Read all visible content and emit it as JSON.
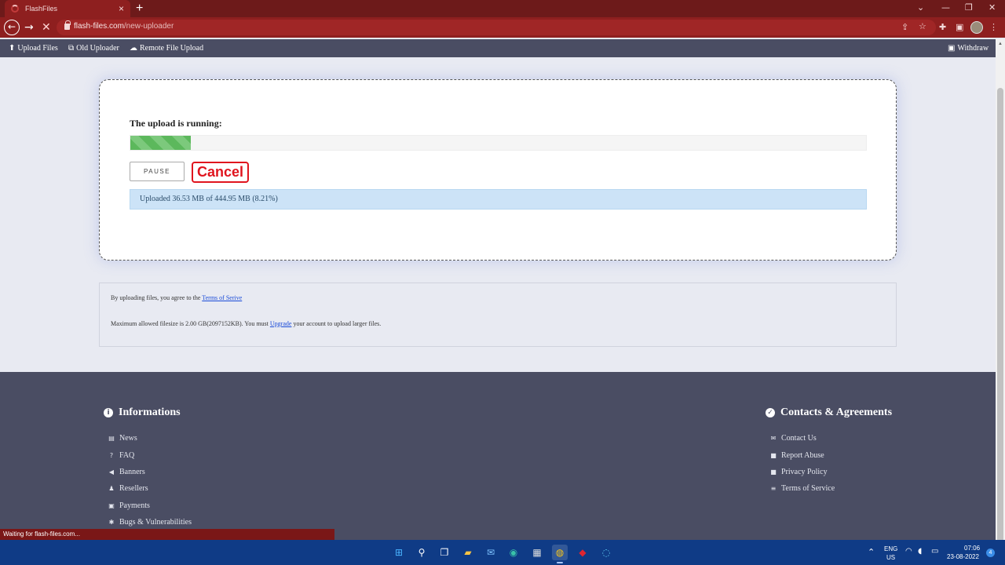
{
  "browser": {
    "tab_title": "FlashFiles",
    "url_domain": "flash-files.com",
    "url_path": "/new-uploader",
    "status_text": "Waiting for flash-files.com..."
  },
  "nav": {
    "upload_files": "Upload Files",
    "old_uploader": "Old Uploader",
    "remote_upload": "Remote File Upload",
    "withdraw": "Withdraw"
  },
  "upload": {
    "title": "The upload is running:",
    "progress_percent": 8.21,
    "pause_label": "PAUSE",
    "cancel_label": "Cancel",
    "status": "Uploaded 36.53 MB of 444.95 MB (8.21%)"
  },
  "info": {
    "agree_prefix": "By uploading files, you agree to the ",
    "terms_link": "Terms of Serive",
    "max_prefix": "Maximum allowed filesize is 2.00 GB(2097152KB). You must ",
    "upgrade_link": "Upgrade",
    "max_suffix": " your account to upload larger files."
  },
  "footer": {
    "informations_title": "Informations",
    "informations": [
      "News",
      "FAQ",
      "Banners",
      "Resellers",
      "Payments",
      "Bugs & Vulnerabilities"
    ],
    "contacts_title": "Contacts & Agreements",
    "contacts": [
      "Contact Us",
      "Report Abuse",
      "Privacy Policy",
      "Terms of Service"
    ]
  },
  "taskbar": {
    "lang": "ENG",
    "region": "US",
    "time": "07:06",
    "date": "23-08-2022",
    "notifications": "4"
  },
  "colors": {
    "chrome_dark": "#6d1a1a",
    "chrome": "#8e1f1f",
    "nav_bg": "#4a4d63",
    "progress_green": "#5cb85c",
    "cancel_red": "#e0141e",
    "status_blue": "#cce3f7"
  },
  "icons": {
    "upload_files": "upload-icon",
    "old_uploader": "copy-icon",
    "remote_upload": "cloud-upload-icon",
    "withdraw": "money-icon",
    "informations": [
      "newspaper-icon",
      "question-icon",
      "bullhorn-icon",
      "users-icon",
      "money-icon",
      "bug-icon"
    ],
    "contacts": [
      "envelope-icon",
      "lock-icon",
      "shield-lock-icon",
      "list-icon"
    ]
  }
}
